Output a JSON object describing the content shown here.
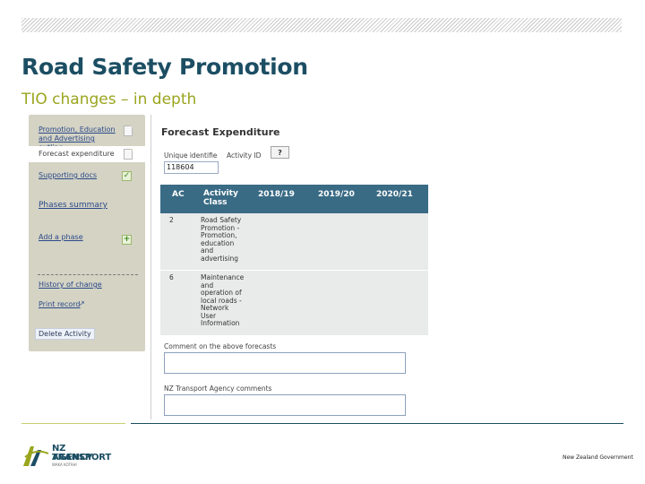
{
  "slide": {
    "title": "Road Safety Promotion",
    "subtitle": "TIO changes – in depth"
  },
  "sidebar": {
    "items": [
      {
        "label": "Promotion, Education and Advertising outline",
        "icon": "document-icon"
      },
      {
        "label": "Forecast expenditure",
        "icon": "document-icon",
        "active": true
      },
      {
        "label": "Supporting docs",
        "icon": "green-check-icon"
      },
      {
        "label": "Phases summary"
      },
      {
        "label": "Add a phase",
        "icon": "green-plus-icon"
      },
      {
        "label": "History of change"
      },
      {
        "label": "Print record"
      }
    ],
    "delete_label": "Delete Activity"
  },
  "form": {
    "title": "Forecast Expenditure",
    "unique_id_label": "Unique identifie",
    "activity_id_label": "Activity ID",
    "help_label": "?",
    "unique_id_value": "118604",
    "table": {
      "headers": [
        "AC",
        "Activity Class",
        "2018/19",
        "2019/20",
        "2020/21"
      ],
      "rows": [
        {
          "ac": "2",
          "activity_class": [
            "Road Safety",
            "Promotion -",
            "Promotion,",
            "education",
            "and",
            "advertising"
          ]
        },
        {
          "ac": "6",
          "activity_class": [
            "Maintenance",
            "and",
            "operation of",
            "local roads -",
            "Network",
            "User",
            "Information"
          ]
        }
      ]
    },
    "comment_label": "Comment on the above forecasts",
    "nzta_comment_label": "NZ Transport Agency comments"
  },
  "footer": {
    "logo_line1": "NZ TRANSPORT",
    "logo_line2": "AGENCY",
    "logo_sub": "WAKA KOTAHI",
    "government": "New Zealand Government"
  },
  "colors": {
    "title": "#1c4e63",
    "subtitle": "#9aa51e",
    "table_header": "#3a6b85",
    "sidebar_bg": "#d4d3c4"
  }
}
